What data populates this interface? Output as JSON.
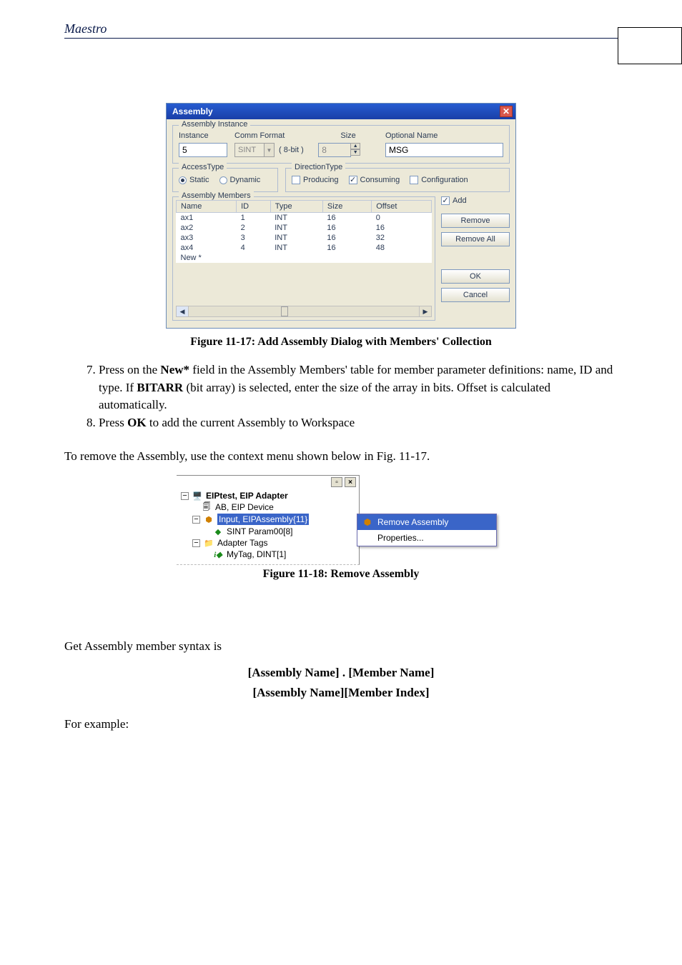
{
  "header": {
    "running_head": "Maestro"
  },
  "dialog": {
    "title": "Assembly",
    "groups": {
      "assembly_instance": "Assembly Instance",
      "access_type": "AccessType",
      "direction_type": "DirectionType",
      "members": "Assembly Members"
    },
    "labels": {
      "instance": "Instance",
      "comm_format": "Comm Format",
      "size": "Size",
      "optional_name": "Optional Name",
      "bits": "( 8-bit )"
    },
    "values": {
      "instance": "5",
      "comm_format": "SINT",
      "size": "8",
      "optional_name": "MSG"
    },
    "access": {
      "static": "Static",
      "dynamic": "Dynamic",
      "selected": "static"
    },
    "direction": {
      "producing": "Producing",
      "consuming": "Consuming",
      "configuration": "Configuration",
      "producing_checked": false,
      "consuming_checked": true,
      "configuration_checked": false
    },
    "members_headers": {
      "name": "Name",
      "id": "ID",
      "type": "Type",
      "size": "Size",
      "offset": "Offset"
    },
    "members": [
      {
        "name": "ax1",
        "id": "1",
        "type": "INT",
        "size": "16",
        "offset": "0"
      },
      {
        "name": "ax2",
        "id": "2",
        "type": "INT",
        "size": "16",
        "offset": "16"
      },
      {
        "name": "ax3",
        "id": "3",
        "type": "INT",
        "size": "16",
        "offset": "32"
      },
      {
        "name": "ax4",
        "id": "4",
        "type": "INT",
        "size": "16",
        "offset": "48"
      },
      {
        "name": "New *",
        "id": "",
        "type": "",
        "size": "",
        "offset": ""
      }
    ],
    "buttons": {
      "add": "Add",
      "remove": "Remove",
      "remove_all": "Remove All",
      "ok": "OK",
      "cancel": "Cancel"
    }
  },
  "captions": {
    "fig_11_17": "Figure 11-17: Add Assembly Dialog with Members' Collection",
    "fig_11_18": "Figure 11-18: Remove Assembly"
  },
  "steps": {
    "s7_a": "Press on the ",
    "s7_new": "New*",
    "s7_b": " field in the Assembly Members' table for member parameter definitions: name, ID and type. If ",
    "s7_bitarr": "BITARR",
    "s7_c": " (bit array) is selected, enter the size of the array in bits. Offset is calculated automatically.",
    "s8_a": "Press ",
    "s8_ok": "OK",
    "s8_b": " to add the current Assembly to Workspace"
  },
  "para_remove": "To remove the Assembly, use the context menu shown below in Fig. 11-17.",
  "tree": {
    "root": "EIPtest, EIP Adapter",
    "n1": "AB, EIP Device",
    "n2": "Input, EIPAssembly{11}",
    "n3": "SINT Param00[8]",
    "n4": "Adapter Tags",
    "n5": "MyTag, DINT[1]"
  },
  "menu": {
    "remove_assembly": "Remove Assembly",
    "properties": "Properties..."
  },
  "syntax": {
    "intro": "Get Assembly member syntax is",
    "line1": "[Assembly Name] . [Member Name]",
    "line2": "[Assembly Name][Member Index]",
    "example": "For example:"
  }
}
